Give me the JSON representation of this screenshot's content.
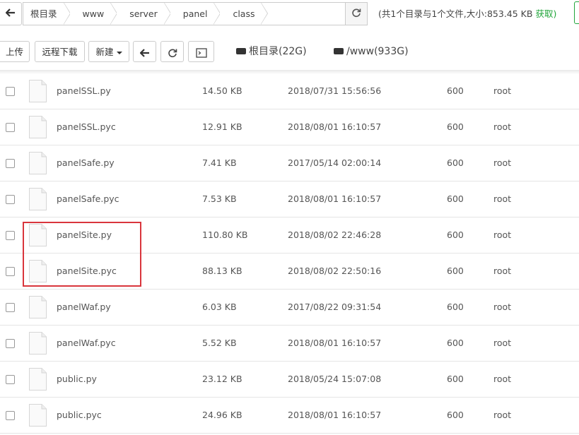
{
  "breadcrumb": {
    "back_icon": "arrow-left-icon",
    "items": [
      "根目录",
      "www",
      "server",
      "panel",
      "class"
    ],
    "refresh_icon": "refresh-icon",
    "summary": "(共1个目录与1个文件,大小:853.45 KB",
    "get_label": "获取)"
  },
  "toolbar": {
    "upload": "上传",
    "remote_download": "远程下载",
    "new": "新建",
    "back_icon": "arrow-left-icon",
    "refresh_icon": "refresh-icon",
    "terminal_icon": "terminal-icon",
    "disks": [
      {
        "label": "根目录(22G)",
        "icon": "hdd-icon"
      },
      {
        "label": "/www(933G)",
        "icon": "hdd-icon"
      }
    ]
  },
  "files": [
    {
      "name": "panelSSL.py",
      "size": "14.50 KB",
      "date": "2018/07/31 15:56:56",
      "perm": "600",
      "owner": "root"
    },
    {
      "name": "panelSSL.pyc",
      "size": "12.91 KB",
      "date": "2018/08/01 16:10:57",
      "perm": "600",
      "owner": "root"
    },
    {
      "name": "panelSafe.py",
      "size": "7.41 KB",
      "date": "2017/05/14 02:00:14",
      "perm": "600",
      "owner": "root"
    },
    {
      "name": "panelSafe.pyc",
      "size": "7.53 KB",
      "date": "2018/08/01 16:10:57",
      "perm": "600",
      "owner": "root"
    },
    {
      "name": "panelSite.py",
      "size": "110.80 KB",
      "date": "2018/08/02 22:46:28",
      "perm": "600",
      "owner": "root"
    },
    {
      "name": "panelSite.pyc",
      "size": "88.13 KB",
      "date": "2018/08/02 22:50:16",
      "perm": "600",
      "owner": "root"
    },
    {
      "name": "panelWaf.py",
      "size": "6.03 KB",
      "date": "2017/08/22 09:31:54",
      "perm": "600",
      "owner": "root"
    },
    {
      "name": "panelWaf.pyc",
      "size": "5.52 KB",
      "date": "2018/08/01 16:10:57",
      "perm": "600",
      "owner": "root"
    },
    {
      "name": "public.py",
      "size": "23.12 KB",
      "date": "2018/05/24 15:07:08",
      "perm": "600",
      "owner": "root"
    },
    {
      "name": "public.pyc",
      "size": "24.96 KB",
      "date": "2018/08/01 16:10:57",
      "perm": "600",
      "owner": "root"
    }
  ],
  "colors": {
    "accent_green": "#20a53a",
    "highlight_red": "#d9353c"
  }
}
